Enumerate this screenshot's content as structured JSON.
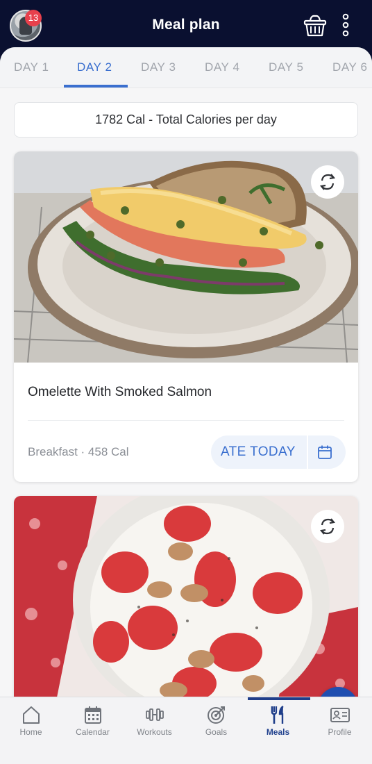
{
  "header": {
    "title": "Meal plan",
    "notification_count": "13",
    "icons": [
      "avatar",
      "basket-icon",
      "more-vertical-icon"
    ]
  },
  "tabs": [
    {
      "label": "DAY 1",
      "active": false
    },
    {
      "label": "DAY 2",
      "active": true
    },
    {
      "label": "DAY 3",
      "active": false
    },
    {
      "label": "DAY 4",
      "active": false
    },
    {
      "label": "DAY 5",
      "active": false
    },
    {
      "label": "DAY 6",
      "active": false
    }
  ],
  "calories_summary": "1782 Cal - Total Calories per day",
  "meals": [
    {
      "name": "Omelette With Smoked Salmon",
      "meta": "Breakfast · 458 Cal",
      "action_label": "ATE TODAY",
      "icons": [
        "swap-icon",
        "calendar-icon"
      ]
    },
    {
      "name": "",
      "meta": "",
      "icons": [
        "swap-icon"
      ]
    }
  ],
  "fab_icon": "plus-icon",
  "bottom_nav": [
    {
      "label": "Home",
      "icon": "home-icon",
      "active": false
    },
    {
      "label": "Calendar",
      "icon": "calendar-grid-icon",
      "active": false
    },
    {
      "label": "Workouts",
      "icon": "dumbbell-icon",
      "active": false
    },
    {
      "label": "Goals",
      "icon": "target-icon",
      "active": false
    },
    {
      "label": "Meals",
      "icon": "fork-knife-icon",
      "active": true
    },
    {
      "label": "Profile",
      "icon": "profile-card-icon",
      "active": false
    }
  ],
  "colors": {
    "header_bg": "#0a1030",
    "accent": "#3a6fcf",
    "fab": "#1f4eb0",
    "badge": "#e8404c",
    "nav_active": "#23438f"
  }
}
